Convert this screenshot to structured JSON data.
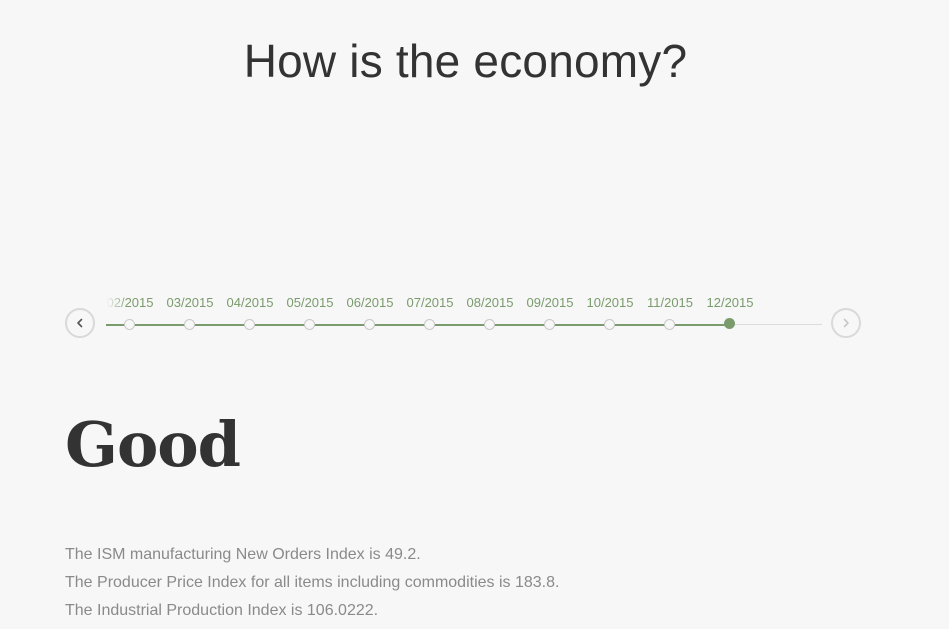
{
  "header": {
    "title": "How is the economy?"
  },
  "timeline": {
    "accent_color": "#7a9b6c",
    "prev_icon": "chevron-left-icon",
    "next_icon": "chevron-right-icon",
    "selected_index": 10,
    "dates": [
      "02/2015",
      "03/2015",
      "04/2015",
      "05/2015",
      "06/2015",
      "07/2015",
      "08/2015",
      "09/2015",
      "10/2015",
      "11/2015",
      "12/2015"
    ]
  },
  "result": {
    "verdict": "Good",
    "stats": [
      "The ISM manufacturing New Orders Index is 49.2.",
      "The Producer Price Index for all items including commodities is 183.8.",
      "The Industrial Production Index is 106.0222."
    ]
  }
}
